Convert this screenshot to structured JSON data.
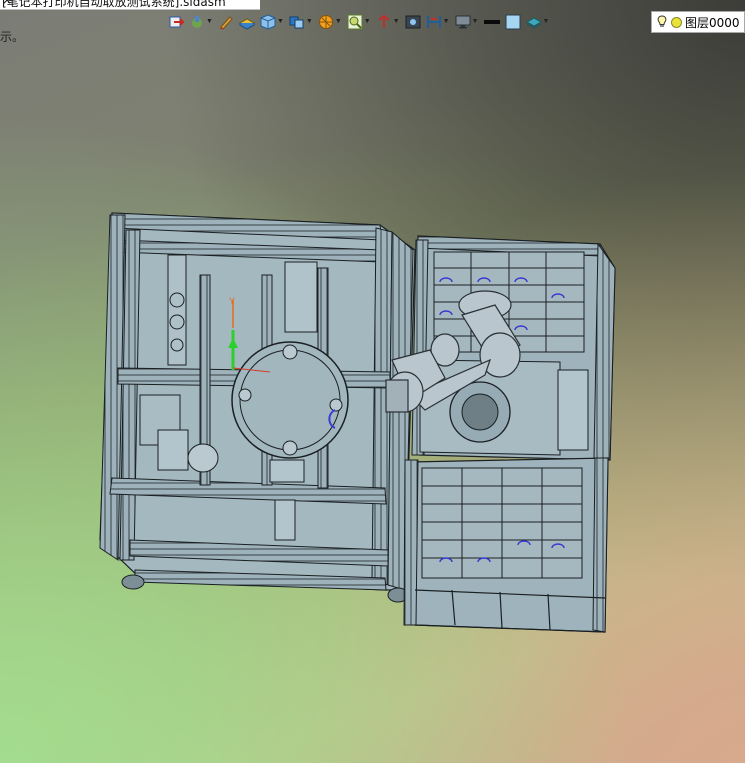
{
  "window": {
    "title_fragment": "[笔记本打印机自动取放测试系统].sldasm",
    "left_note": "示。"
  },
  "toolbar": {
    "items": [
      {
        "icon": "exit-sketch-icon",
        "dropdown": false
      },
      {
        "icon": "smart-dimension-icon",
        "dropdown": true
      },
      {
        "icon": "edit-pencil-icon",
        "dropdown": false
      },
      {
        "icon": "section-view-icon",
        "dropdown": false
      },
      {
        "icon": "view-orientation-cube-icon",
        "dropdown": true
      },
      {
        "icon": "display-style-icon",
        "dropdown": true
      },
      {
        "icon": "hide-show-items-icon",
        "dropdown": true
      },
      {
        "icon": "edit-appearance-icon",
        "dropdown": true
      },
      {
        "icon": "apply-scene-icon",
        "dropdown": true
      },
      {
        "icon": "view-settings-icon",
        "dropdown": false
      },
      {
        "icon": "rotate-view-icon",
        "dropdown": true
      },
      {
        "icon": "monitor-icon",
        "dropdown": true
      },
      {
        "icon": "line-color-icon",
        "dropdown": false
      },
      {
        "icon": "color-box-icon",
        "dropdown": false
      },
      {
        "icon": "layers-icon",
        "dropdown": true
      }
    ]
  },
  "layer": {
    "label": "图层0000"
  },
  "triad": {
    "y_label": "Y"
  },
  "colors": {
    "frame": "#9fb4bd",
    "frame_edge": "#1a1f22",
    "robot_arm": "#b7c4cc"
  }
}
